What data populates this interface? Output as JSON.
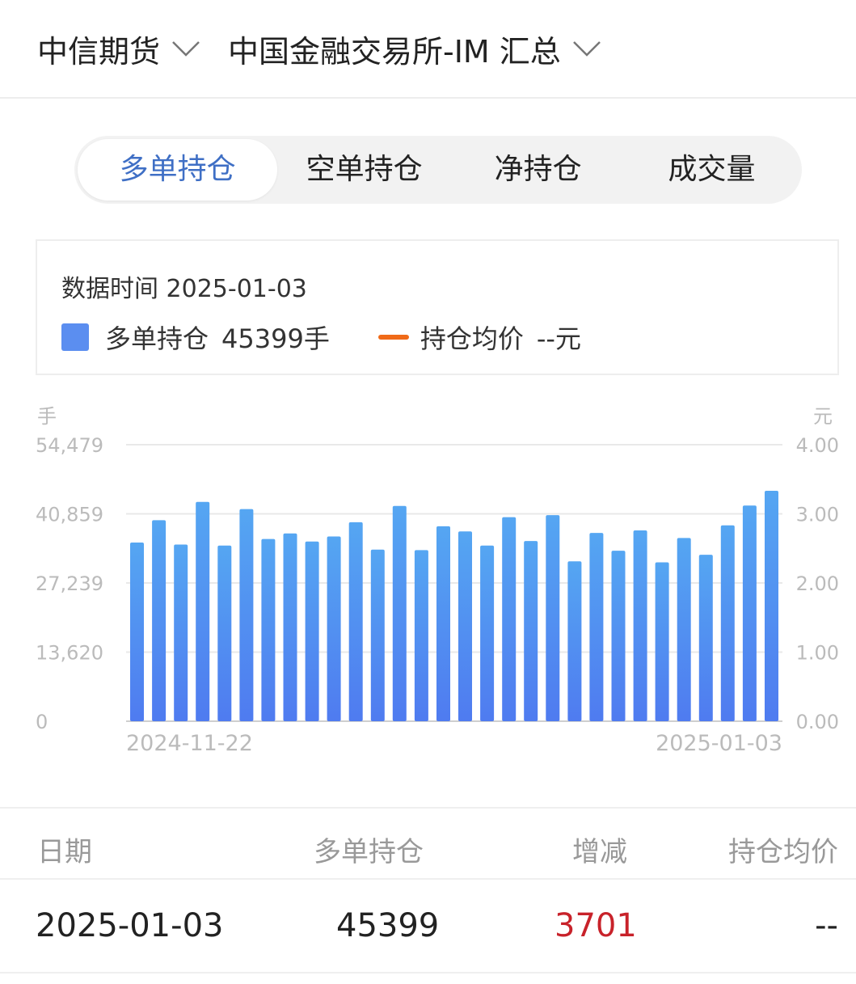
{
  "header": {
    "broker": "中信期货",
    "contract": "中国金融交易所-IM 汇总"
  },
  "tabs": [
    {
      "label": "多单持仓",
      "active": true
    },
    {
      "label": "空单持仓",
      "active": false
    },
    {
      "label": "净持仓",
      "active": false
    },
    {
      "label": "成交量",
      "active": false
    }
  ],
  "info": {
    "time": "数据时间 2025-01-03",
    "legend_bar_name": "多单持仓",
    "legend_bar_value": "45399手",
    "legend_line_name": "持仓均价",
    "legend_line_value": "--元"
  },
  "colors": {
    "active_tab": "#3f6fc5",
    "bar_top": "#55a6f2",
    "bar_bottom": "#4f7bf0",
    "line": "#f06a18",
    "increase": "#c8222a"
  },
  "chart_data": {
    "type": "bar",
    "y_unit_left": "手",
    "y_unit_right": "元",
    "yticks_left": [
      "54,479",
      "40,859",
      "27,239",
      "13,620",
      "0"
    ],
    "yticks_right": [
      "4.00",
      "3.00",
      "2.00",
      "1.00",
      "0.00"
    ],
    "ylim_left": [
      0,
      54479
    ],
    "ylim_right": [
      0,
      4
    ],
    "x_start_label": "2024-11-22",
    "x_end_label": "2025-01-03",
    "grid": true,
    "series": [
      {
        "name": "多单持仓",
        "values": [
          35200,
          39600,
          34800,
          43200,
          34600,
          41800,
          35900,
          37000,
          35400,
          36400,
          39200,
          33800,
          42400,
          33700,
          38400,
          37400,
          34600,
          40200,
          35500,
          40600,
          31500,
          37100,
          33600,
          37600,
          31300,
          36100,
          32800,
          38600,
          42500,
          45399
        ]
      },
      {
        "name": "持仓均价",
        "values": []
      }
    ]
  },
  "table": {
    "headers": [
      "日期",
      "多单持仓",
      "增减",
      "持仓均价"
    ],
    "rows": [
      {
        "date": "2025-01-03",
        "long": "45399",
        "change": "3701",
        "avg": "--"
      }
    ]
  }
}
